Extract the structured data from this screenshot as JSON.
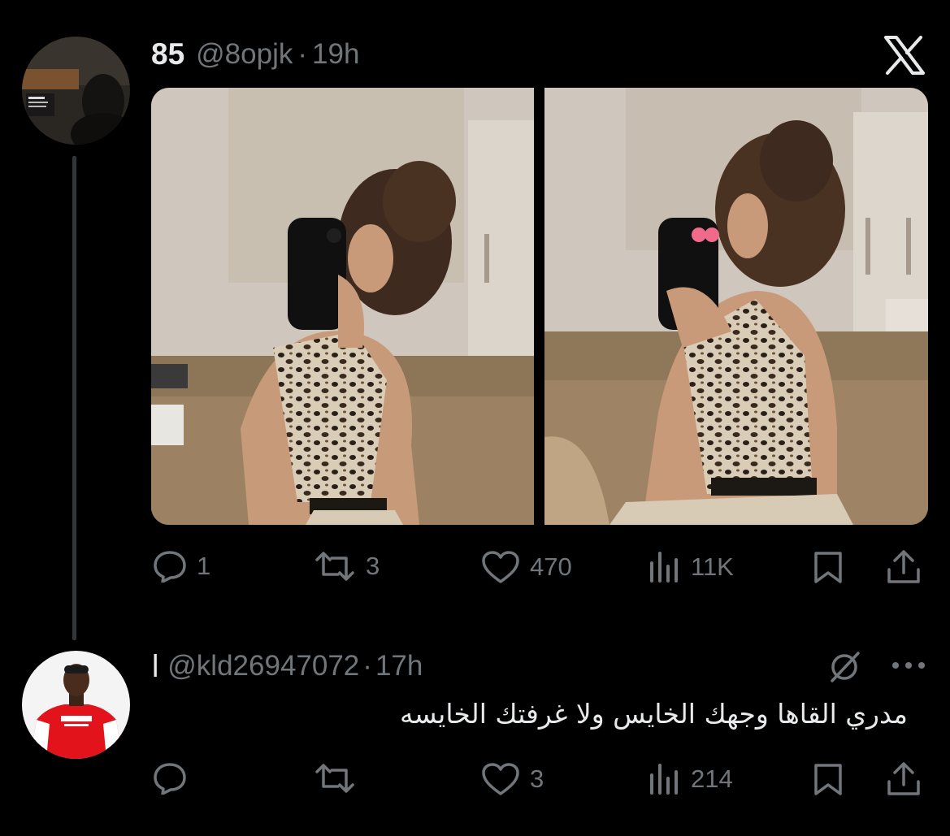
{
  "post": {
    "display_name": "85",
    "handle": "@8opjk",
    "separator": "·",
    "time": "19h",
    "stats": {
      "replies": "1",
      "reposts": "3",
      "likes": "470",
      "views": "11K"
    }
  },
  "reply": {
    "display_name": "ا",
    "handle": "@kld26947072",
    "separator": "·",
    "time": "17h",
    "text": "مدري القاها وجهك الخايس ولا غرفتك الخايسه",
    "stats": {
      "replies": "",
      "reposts": "",
      "likes": "3",
      "views": "214"
    }
  },
  "icons": {
    "brand": "x-logo-icon",
    "reply": "comment-bubble-icon",
    "repost": "repost-arrows-icon",
    "like": "heart-icon",
    "views": "bar-chart-icon",
    "bookmark": "bookmark-icon",
    "share": "share-upload-icon",
    "grok": "grok-slash-circle-icon",
    "more": "more-dots-icon"
  },
  "colors": {
    "background": "#000000",
    "text": "#e7e9ea",
    "muted": "#71767b",
    "thread_line": "#333639"
  }
}
